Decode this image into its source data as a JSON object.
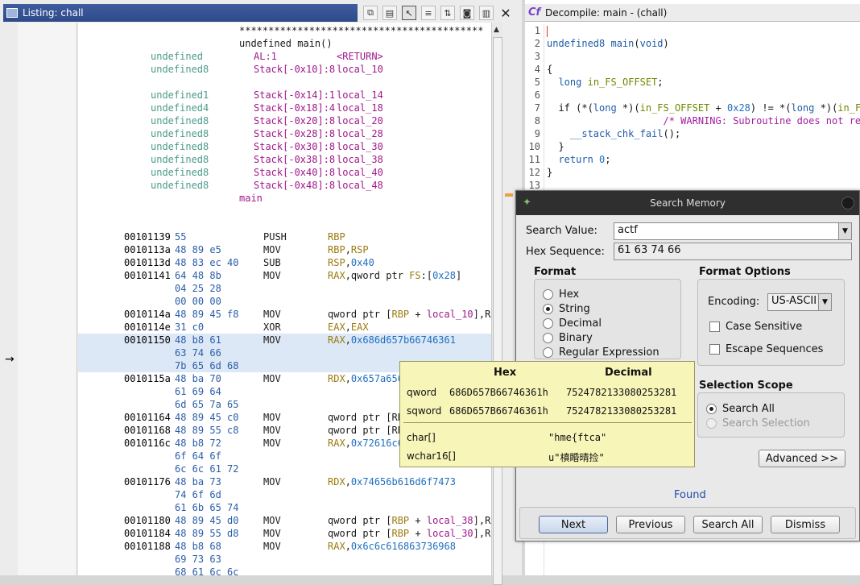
{
  "listing": {
    "title": "Listing:  chall",
    "header": {
      "stars": "******************************************",
      "signature": "undefined main()",
      "func_label": "main",
      "vars": [
        {
          "type": "undefined",
          "loc": "AL:1",
          "name": "<RETURN>"
        },
        {
          "type": "undefined8",
          "loc": "Stack[-0x10]:8",
          "name": "local_10"
        },
        {
          "type": "undefined1",
          "loc": "Stack[-0x14]:1",
          "name": "local_14"
        },
        {
          "type": "undefined4",
          "loc": "Stack[-0x18]:4",
          "name": "local_18"
        },
        {
          "type": "undefined8",
          "loc": "Stack[-0x20]:8",
          "name": "local_20"
        },
        {
          "type": "undefined8",
          "loc": "Stack[-0x28]:8",
          "name": "local_28"
        },
        {
          "type": "undefined8",
          "loc": "Stack[-0x30]:8",
          "name": "local_30"
        },
        {
          "type": "undefined8",
          "loc": "Stack[-0x38]:8",
          "name": "local_38"
        },
        {
          "type": "undefined8",
          "loc": "Stack[-0x40]:8",
          "name": "local_40"
        },
        {
          "type": "undefined8",
          "loc": "Stack[-0x48]:8",
          "name": "local_48"
        }
      ]
    },
    "instructions": [
      {
        "addr": "00101139",
        "bytes": "55",
        "mn": "PUSH",
        "op": "RBP"
      },
      {
        "addr": "0010113a",
        "bytes": "48 89 e5",
        "mn": "MOV",
        "op": "RBP,RSP"
      },
      {
        "addr": "0010113d",
        "bytes": "48 83 ec 40",
        "mn": "SUB",
        "op": "RSP,0x40"
      },
      {
        "addr": "00101141",
        "bytes": "64 48 8b",
        "mn": "MOV",
        "op": "RAX,qword ptr FS:[0x28]"
      },
      {
        "addr": "",
        "bytes": "04 25 28",
        "mn": "",
        "op": ""
      },
      {
        "addr": "",
        "bytes": "00 00 00",
        "mn": "",
        "op": ""
      },
      {
        "addr": "0010114a",
        "bytes": "48 89 45 f8",
        "mn": "MOV",
        "op": "qword ptr [RBP + local_10],RA"
      },
      {
        "addr": "0010114e",
        "bytes": "31 c0",
        "mn": "XOR",
        "op": "EAX,EAX"
      },
      {
        "addr": "00101150",
        "bytes": "48 b8 61",
        "mn": "MOV",
        "op": "RAX,0x686d657b66746361"
      },
      {
        "addr": "",
        "bytes": "63 74 66",
        "mn": "",
        "op": ""
      },
      {
        "addr": "",
        "bytes": "7b 65 6d 68",
        "mn": "",
        "op": ""
      },
      {
        "addr": "0010115a",
        "bytes": "48 ba 70",
        "mn": "MOV",
        "op": "RDX,0x657a656"
      },
      {
        "addr": "",
        "bytes": "61 69 64",
        "mn": "",
        "op": ""
      },
      {
        "addr": "",
        "bytes": "6d 65 7a 65",
        "mn": "",
        "op": ""
      },
      {
        "addr": "00101164",
        "bytes": "48 89 45 c0",
        "mn": "MOV",
        "op": "qword ptr [RB"
      },
      {
        "addr": "00101168",
        "bytes": "48 89 55 c8",
        "mn": "MOV",
        "op": "qword ptr [RB"
      },
      {
        "addr": "0010116c",
        "bytes": "48 b8 72",
        "mn": "MOV",
        "op": "RAX,0x72616c6"
      },
      {
        "addr": "",
        "bytes": "6f 64 6f",
        "mn": "",
        "op": ""
      },
      {
        "addr": "",
        "bytes": "6c 6c 61 72",
        "mn": "",
        "op": ""
      },
      {
        "addr": "00101176",
        "bytes": "48 ba 73",
        "mn": "MOV",
        "op": "RDX,0x74656b616d6f7473"
      },
      {
        "addr": "",
        "bytes": "74 6f 6d",
        "mn": "",
        "op": ""
      },
      {
        "addr": "",
        "bytes": "61 6b 65 74",
        "mn": "",
        "op": ""
      },
      {
        "addr": "00101180",
        "bytes": "48 89 45 d0",
        "mn": "MOV",
        "op": "qword ptr [RBP + local_38],RA"
      },
      {
        "addr": "00101184",
        "bytes": "48 89 55 d8",
        "mn": "MOV",
        "op": "qword ptr [RBP + local_30],RD"
      },
      {
        "addr": "00101188",
        "bytes": "48 b8 68",
        "mn": "MOV",
        "op": "RAX,0x6c6c616863736968"
      },
      {
        "addr": "",
        "bytes": "69 73 63",
        "mn": "",
        "op": ""
      },
      {
        "addr": "",
        "bytes": "68 61 6c 6c",
        "mn": "",
        "op": ""
      }
    ]
  },
  "decompile": {
    "title": "Decompile: main -  (chall)",
    "lines": [
      "",
      "undefined8 main(void)",
      "",
      "{",
      "  long in_FS_OFFSET;",
      "",
      "  if (*(long *)(in_FS_OFFSET + 0x28) != *(long *)(in_FS_OFFSET + 0x28)) {",
      "                    /* WARNING: Subroutine does not return */",
      "    __stack_chk_fail();",
      "  }",
      "  return 0;",
      "}",
      ""
    ],
    "line_numbers": [
      "1",
      "2",
      "3",
      "4",
      "5",
      "6",
      "7",
      "8",
      "9",
      "10",
      "11",
      "12",
      "13"
    ]
  },
  "dialog": {
    "title": "Search Memory",
    "search_value_label": "Search Value:",
    "search_value": "actf",
    "hex_seq_label": "Hex Sequence:",
    "hex_seq": "61 63 74 66",
    "format_head": "Format",
    "formats": [
      "Hex",
      "String",
      "Decimal",
      "Binary",
      "Regular Expression"
    ],
    "format_options_head": "Format Options",
    "encoding_label": "Encoding:",
    "encoding_value": "US-ASCII",
    "case_sensitive": "Case Sensitive",
    "escape_sequences": "Escape Sequences",
    "scope_head": "Selection Scope",
    "scope_all": "Search All",
    "scope_selection": "Search Selection",
    "advanced": "Advanced >>",
    "status": "Found",
    "buttons": {
      "next": "Next",
      "previous": "Previous",
      "search_all": "Search All",
      "dismiss": "Dismiss"
    }
  },
  "tooltip": {
    "col_hex": "Hex",
    "col_dec": "Decimal",
    "rows": [
      {
        "label": "qword",
        "hex": "686D657B66746361h",
        "dec": "7524782133080253281"
      },
      {
        "label": "sqword",
        "hex": "686D657B66746361h",
        "dec": "7524782133080253281"
      }
    ],
    "char_label": "char[]",
    "char_value": "\"hme{ftca\"",
    "wchar_label": "wchar16[]",
    "wchar_value": "u\"橨睧晴捡\""
  }
}
